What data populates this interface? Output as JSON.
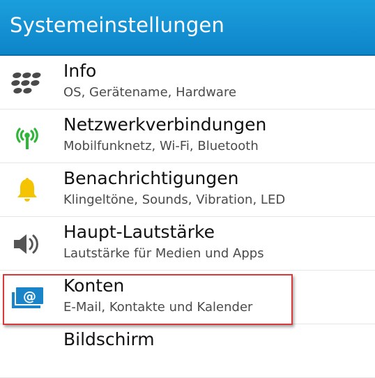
{
  "header": {
    "title": "Systemeinstellungen"
  },
  "items": [
    {
      "title": "Info",
      "subtitle": "OS, Gerätename, Hardware",
      "icon": "blackberry-logo-icon"
    },
    {
      "title": "Netzwerkverbindungen",
      "subtitle": "Mobilfunknetz, Wi-Fi, Bluetooth",
      "icon": "antenna-signal-icon"
    },
    {
      "title": "Benachrichtigungen",
      "subtitle": "Klingeltöne, Sounds, Vibration, LED",
      "icon": "bell-icon"
    },
    {
      "title": "Haupt-Lautstärke",
      "subtitle": "Lautstärke für Medien und Apps",
      "icon": "speaker-icon"
    },
    {
      "title": "Konten",
      "subtitle": "E-Mail, Kontakte und Kalender",
      "icon": "accounts-at-icon"
    },
    {
      "title": "Bildschirm",
      "subtitle": "",
      "icon": "display-icon"
    }
  ],
  "colors": {
    "header_bg": "#1b9fdc",
    "highlight_border": "#d83a3a",
    "network_green": "#2fb53a",
    "bell_yellow": "#f5c400",
    "accounts_blue": "#1a84c8"
  }
}
